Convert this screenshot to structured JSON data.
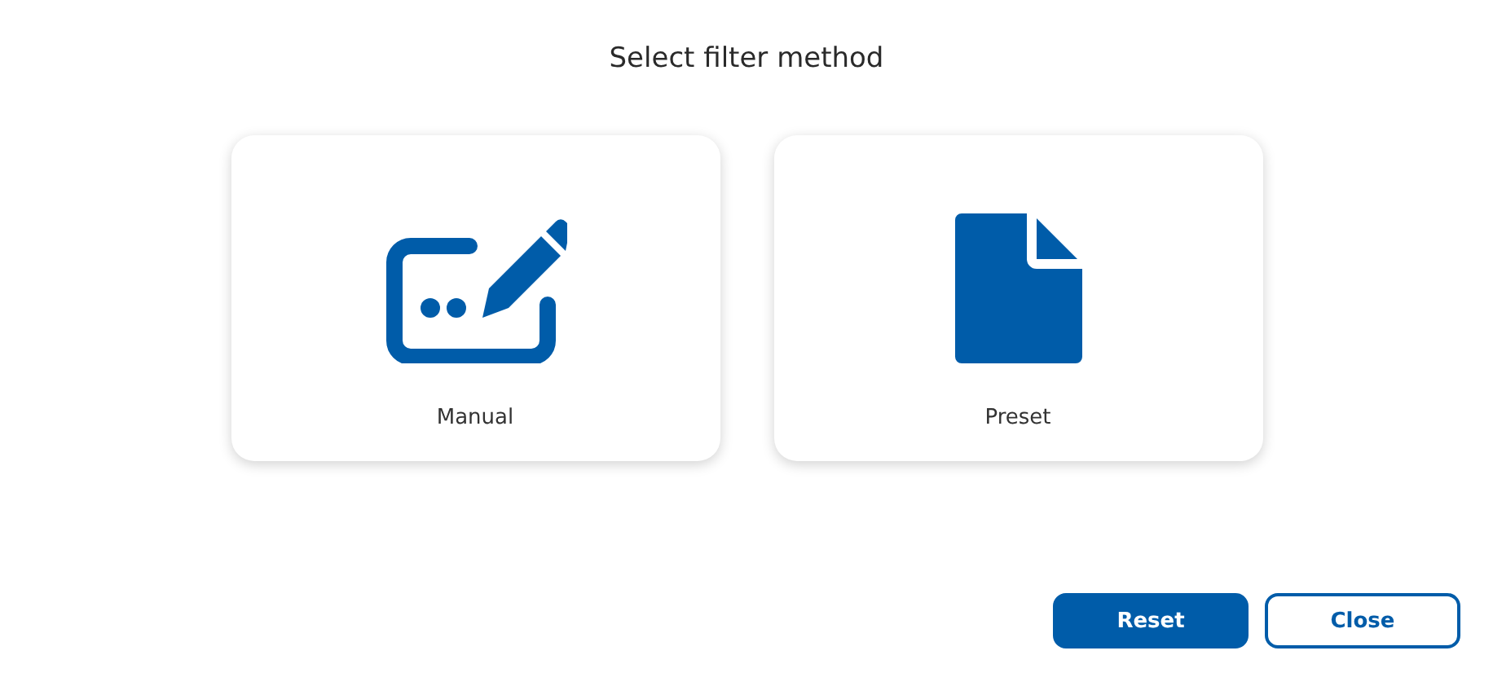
{
  "title": "Select filter method",
  "options": [
    {
      "label": "Manual",
      "kind": "manual"
    },
    {
      "label": "Preset",
      "kind": "preset"
    }
  ],
  "buttons": [
    {
      "label": "Reset",
      "kind": "primary"
    },
    {
      "label": "Close",
      "kind": "secondary"
    }
  ]
}
